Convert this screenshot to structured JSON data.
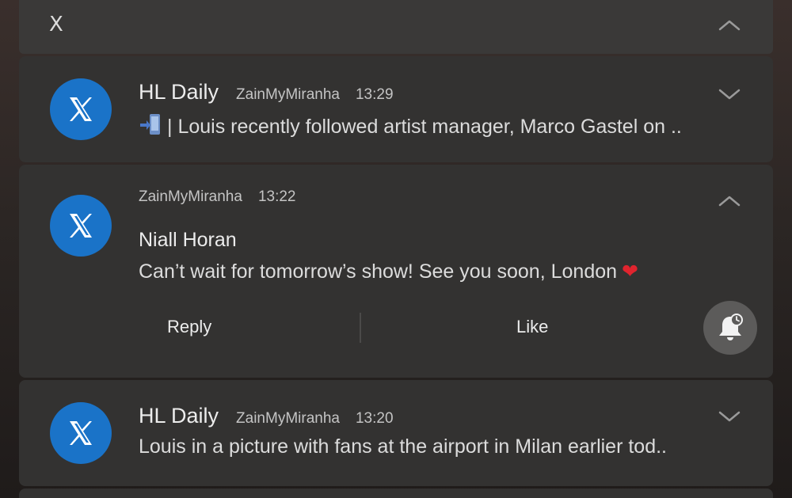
{
  "group_header": {
    "app_letter": "X"
  },
  "notifications": [
    {
      "app": "HL Daily",
      "account": "ZainMyMiranha",
      "time": "13:29",
      "text": "| Louis recently followed artist manager, Marco Gastel on ..",
      "leading_icon": "phone-arrow-emoji-icon",
      "expanded": false
    },
    {
      "account": "ZainMyMiranha",
      "time": "13:22",
      "sender": "Niall Horan",
      "text": "Can’t wait for tomorrow’s show! See you soon, London",
      "trailing_icon": "red-heart-emoji-icon",
      "expanded": true,
      "actions": {
        "reply": "Reply",
        "like": "Like"
      }
    },
    {
      "app": "HL Daily",
      "account": "ZainMyMiranha",
      "time": "13:20",
      "text": "Louis in a picture with fans at the airport in Milan earlier tod..",
      "expanded": false
    }
  ],
  "colors": {
    "avatar_bg": "#1a73c8",
    "card_bg": "#333231",
    "heart": "#e0242e"
  }
}
